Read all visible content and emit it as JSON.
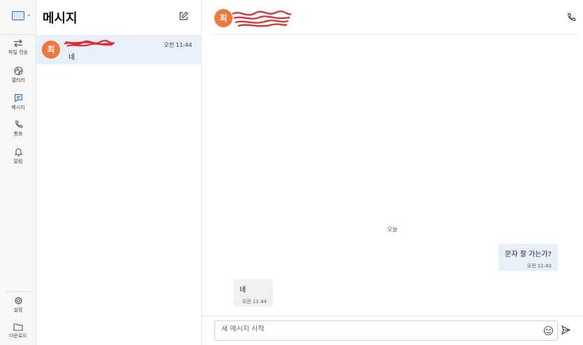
{
  "rail": {
    "items": [
      {
        "label": "파일 전송",
        "icon": "transfer-arrows-icon"
      },
      {
        "label": "갤러리",
        "icon": "gallery-aperture-icon"
      },
      {
        "label": "메시지",
        "icon": "message-bubble-icon",
        "active": true
      },
      {
        "label": "통화",
        "icon": "phone-icon"
      },
      {
        "label": "알림",
        "icon": "bell-icon"
      }
    ],
    "bottom": [
      {
        "label": "설정",
        "icon": "gear-icon"
      },
      {
        "label": "다운로드",
        "icon": "folder-icon"
      }
    ]
  },
  "conversations": {
    "title": "메시지",
    "items": [
      {
        "avatar": "최",
        "preview": "네",
        "time": "오전 11:44",
        "selected": true
      }
    ]
  },
  "chat": {
    "avatar": "최",
    "date_separator": "오늘",
    "messages": [
      {
        "direction": "out",
        "text": "문자 잘 가는가?",
        "time": "오전 11:43"
      },
      {
        "direction": "in",
        "text": "네",
        "time": "오전 11:44"
      }
    ],
    "input_placeholder": "새 메시지 시작"
  },
  "colors": {
    "accent": "#2f6fd6",
    "avatar": "#f0783c",
    "selected_row": "#e8f1fb",
    "outgoing_bubble": "#e8f1fb",
    "incoming_bubble": "#f1f1f3",
    "redaction": "#e8262a"
  }
}
